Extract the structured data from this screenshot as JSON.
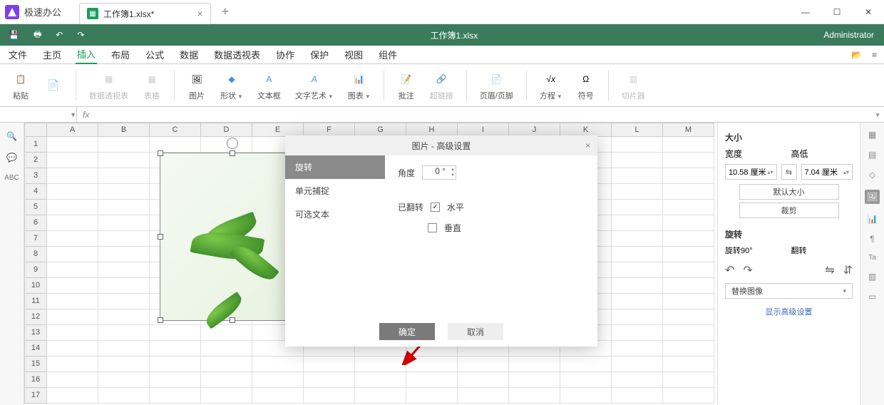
{
  "app": {
    "name": "极速办公"
  },
  "tab": {
    "title": "工作簿1.xlsx*"
  },
  "doc_title": "工作簿1.xlsx",
  "user": "Administrator",
  "menu": {
    "items": [
      "文件",
      "主页",
      "插入",
      "布局",
      "公式",
      "数据",
      "数据透视表",
      "协作",
      "保护",
      "视图",
      "组件"
    ],
    "active": 2
  },
  "ribbon": {
    "paste": "粘贴",
    "pivot": "数据透视表",
    "table": "表格",
    "picture": "图片",
    "shape": "形状",
    "textbox": "文本框",
    "wordart": "文字艺术",
    "chart": "图表",
    "comment": "批注",
    "hyperlink": "超链接",
    "headerfooter": "页眉/页脚",
    "equation": "方程",
    "symbol": "符号",
    "slicer": "切片器"
  },
  "columns": [
    "A",
    "B",
    "C",
    "D",
    "E",
    "F",
    "G",
    "H",
    "I",
    "J",
    "K",
    "L",
    "M"
  ],
  "rows": [
    1,
    2,
    3,
    4,
    5,
    6,
    7,
    8,
    9,
    10,
    11,
    12,
    13,
    14,
    15,
    16,
    17
  ],
  "dialog": {
    "title": "图片 - 高级设置",
    "side": [
      "旋转",
      "单元捕捉",
      "可选文本"
    ],
    "angle_label": "角度",
    "angle_value": "0 °",
    "flipped_label": "已翻转",
    "horizontal": "水平",
    "vertical": "垂直",
    "ok": "确定",
    "cancel": "取消"
  },
  "panel": {
    "size_title": "大小",
    "width_label": "宽度",
    "height_label": "高低",
    "width_value": "10.58 厘米",
    "height_value": "7.04 厘米",
    "default_size": "默认大小",
    "crop": "裁剪",
    "rotate_title": "旋转",
    "rotate90": "旋转90°",
    "flip": "翻转",
    "replace": "替换图像",
    "advanced": "显示高级设置"
  }
}
